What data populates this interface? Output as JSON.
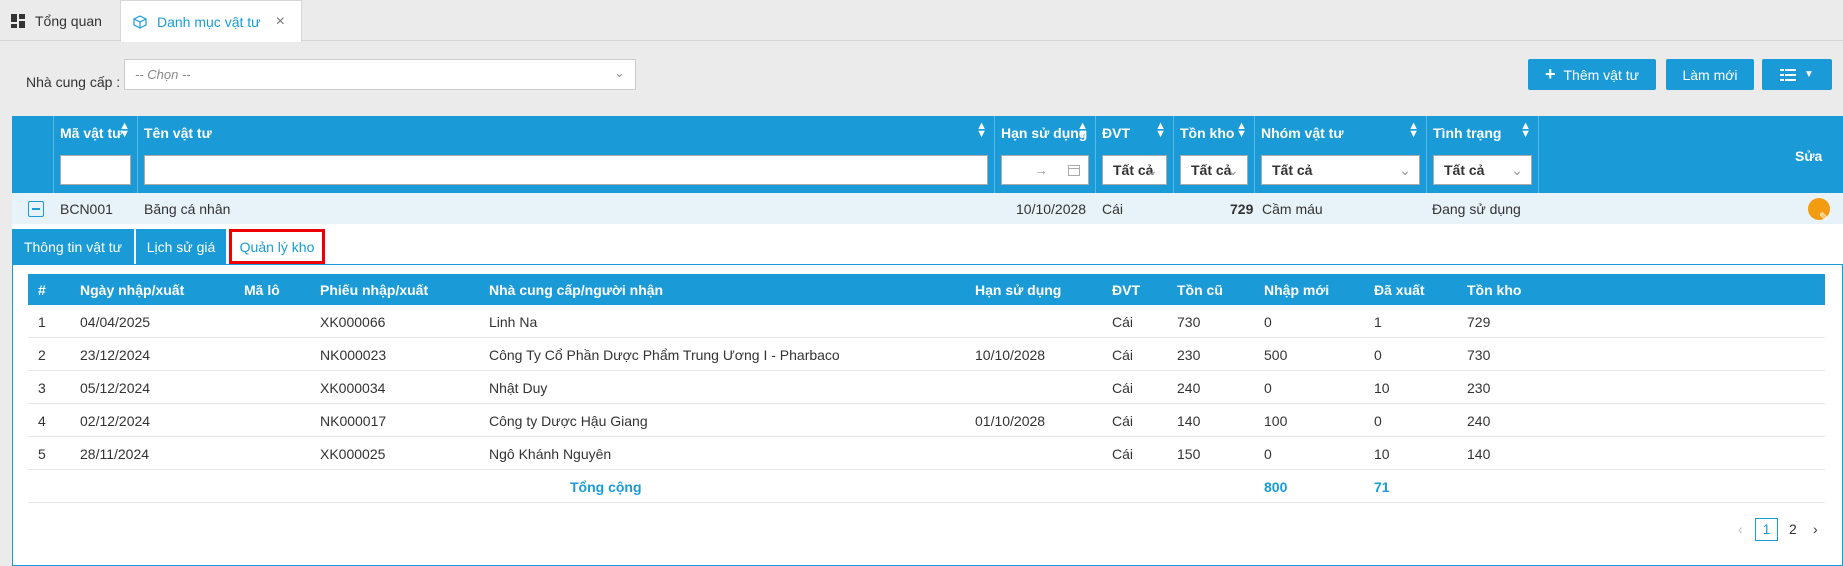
{
  "app_tabs": [
    {
      "label": "Tổng quan",
      "icon": "dashboard-icon"
    },
    {
      "label": "Danh mục vật tư",
      "icon": "box-icon"
    }
  ],
  "toolbar": {
    "supplier_label": "Nhà cung cấp :",
    "supplier_placeholder": "-- Chọn --",
    "add_label": "Thêm vật tư",
    "refresh_label": "Làm mới"
  },
  "grid": {
    "columns": [
      "Mã vật tư",
      "Tên vật tư",
      "Hạn sử dụng",
      "ĐVT",
      "Tồn kho",
      "Nhóm vật tư",
      "Tình trạng",
      "Sửa"
    ],
    "filters": {
      "dvt": "Tất cả",
      "ton_kho": "Tất cả",
      "nhom": "Tất cả",
      "tinh_trang": "Tất cả",
      "date_arrow": "→"
    },
    "row": {
      "ma": "BCN001",
      "ten": "Băng cá nhân",
      "han": "10/10/2028",
      "dvt": "Cái",
      "ton": "729",
      "nhom": "Cầm máu",
      "tinh_trang": "Đang sử dụng"
    }
  },
  "subtabs": [
    "Thông tin vật tư",
    "Lịch sử giá",
    "Quản lý kho"
  ],
  "stock": {
    "headers": [
      "#",
      "Ngày nhập/xuất",
      "Mã lô",
      "Phiếu nhập/xuất",
      "Nhà cung cấp/người nhận",
      "Hạn sử dụng",
      "ĐVT",
      "Tồn cũ",
      "Nhập mới",
      "Đã xuất",
      "Tồn kho"
    ],
    "rows": [
      {
        "n": "1",
        "ngay": "04/04/2025",
        "lo": "",
        "phieu": "XK000066",
        "ncc": "Linh Na",
        "han": "",
        "dvt": "Cái",
        "cu": "730",
        "nhap": "0",
        "xuat": "1",
        "ton": "729"
      },
      {
        "n": "2",
        "ngay": "23/12/2024",
        "lo": "",
        "phieu": "NK000023",
        "ncc": "Công Ty Cổ Phần Dược Phẩm Trung Ương I - Pharbaco",
        "han": "10/10/2028",
        "dvt": "Cái",
        "cu": "230",
        "nhap": "500",
        "xuat": "0",
        "ton": "730"
      },
      {
        "n": "3",
        "ngay": "05/12/2024",
        "lo": "",
        "phieu": "XK000034",
        "ncc": "Nhật Duy",
        "han": "",
        "dvt": "Cái",
        "cu": "240",
        "nhap": "0",
        "xuat": "10",
        "ton": "230"
      },
      {
        "n": "4",
        "ngay": "02/12/2024",
        "lo": "",
        "phieu": "NK000017",
        "ncc": "Công ty Dược Hậu Giang",
        "han": "01/10/2028",
        "dvt": "Cái",
        "cu": "140",
        "nhap": "100",
        "xuat": "0",
        "ton": "240"
      },
      {
        "n": "5",
        "ngay": "28/11/2024",
        "lo": "",
        "phieu": "XK000025",
        "ncc": "Ngô Khánh Nguyên",
        "han": "",
        "dvt": "Cái",
        "cu": "150",
        "nhap": "0",
        "xuat": "10",
        "ton": "140"
      }
    ],
    "total_label": "Tổng cộng",
    "total_nhap": "800",
    "total_xuat": "71"
  },
  "pager": {
    "prev": "‹",
    "pages": [
      "1",
      "2"
    ],
    "next": "›"
  }
}
